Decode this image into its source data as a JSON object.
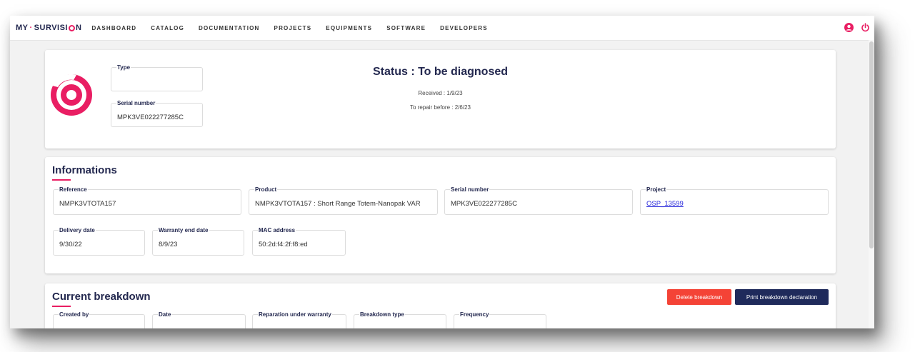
{
  "brand": {
    "left": "MY",
    "separator": "·",
    "right_prefix": "SURVISI",
    "right_suffix": "N"
  },
  "nav": {
    "items": [
      "DASHBOARD",
      "CATALOG",
      "DOCUMENTATION",
      "PROJECTS",
      "EQUIPMENTS",
      "SOFTWARE",
      "DEVELOPERS"
    ]
  },
  "header_icons": [
    "user-icon",
    "power-icon"
  ],
  "colors": {
    "accent": "#e91e63",
    "navy": "#23284f",
    "danger": "#f44336",
    "print": "#1f2a5b"
  },
  "equipment": {
    "type_label": "Type",
    "type_value": "",
    "serial_label": "Serial number",
    "serial_value": "MPK3VE022277285C"
  },
  "status": {
    "title": "Status : To be diagnosed",
    "received": "Received : 1/9/23",
    "repair_before": "To repair before : 2/6/23"
  },
  "informations": {
    "title": "Informations",
    "fields": [
      {
        "label": "Reference",
        "value": "NMPK3VTOTA157"
      },
      {
        "label": "Product",
        "value": "NMPK3VTOTA157 : Short Range Totem-Nanopak VAR"
      },
      {
        "label": "Serial number",
        "value": "MPK3VE022277285C"
      },
      {
        "label": "Project",
        "value": "OSP_13599"
      },
      {
        "label": "Delivery date",
        "value": "9/30/22"
      },
      {
        "label": "Warranty end date",
        "value": "8/9/23"
      },
      {
        "label": "MAC address",
        "value": "50:2d:f4:2f:f8:ed"
      }
    ]
  },
  "breakdown": {
    "title": "Current breakdown",
    "delete_label": "Delete breakdown",
    "print_label": "Print breakdown declaration",
    "fields": [
      {
        "label": "Created by"
      },
      {
        "label": "Date"
      },
      {
        "label": "Reparation under warranty"
      },
      {
        "label": "Breakdown type"
      },
      {
        "label": "Frequency"
      }
    ]
  }
}
